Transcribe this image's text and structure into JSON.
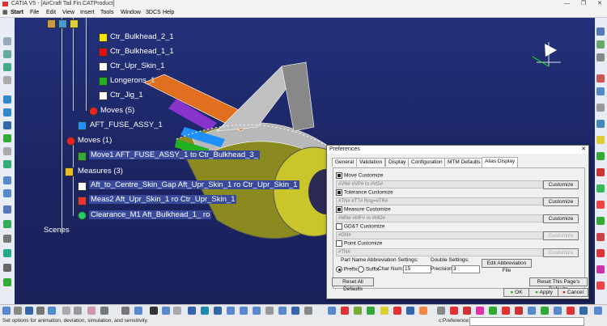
{
  "window": {
    "title": "CATIA V5 - [AirCraft Tail Fin.CATProduct]",
    "controls": [
      "—",
      "❐",
      "✕"
    ]
  },
  "menu": [
    "Start",
    "File",
    "Edit",
    "View",
    "Insert",
    "Tools",
    "Window",
    "3DCS",
    "Help"
  ],
  "tree": {
    "items": [
      {
        "label": "Ctr_Bulkhead_2_1",
        "color": "#f5e400"
      },
      {
        "label": "Ctr_Bulkhead_1_1",
        "color": "#e01010"
      },
      {
        "label": "Ctr_Upr_Skin_1",
        "color": "#ffffff"
      },
      {
        "label": "Longerons_1",
        "color": "#20b020"
      },
      {
        "label": "Ctr_Jig_1",
        "color": "#ffffff"
      },
      {
        "label": "Moves (5)"
      },
      {
        "label": "AFT_FUSE_ASSY_1",
        "color": "#1e90ff"
      },
      {
        "label": "Moves (1)"
      },
      {
        "label": "Move1 AFT_FUSE_ASSY_1 to Ctr_Bulkhead_3_"
      },
      {
        "label": "Measures (3)"
      },
      {
        "label": "Aft_to_Centre_Skin_Gap Aft_Upr_Skin_1 ro Ctr_Upr_Skin_1"
      },
      {
        "label": "Meas2 Aft_Upr_Skin_1 ro Ctr_Upr_Skin_1"
      },
      {
        "label": "Clearance_M1 Aft_Bulkhead_1_ ro"
      },
      {
        "label": "Scenes"
      }
    ]
  },
  "dialog": {
    "title": "Preferences",
    "tabs": [
      "General",
      "Validation",
      "Display",
      "Configuration",
      "MTM Defaults",
      "Alias Display"
    ],
    "active_tab": "Alias Display",
    "sections": [
      {
        "label": "Move Customize",
        "checked": true,
        "value": "#VN# #VP# to #VG#",
        "button": "Customize",
        "enabled": true
      },
      {
        "label": "Tolerance Customize",
        "checked": true,
        "value": "#TN# #TT# Rng=#TR#",
        "button": "Customize",
        "enabled": true
      },
      {
        "label": "Measure Customize",
        "checked": true,
        "value": "#MN# #MF# ro #MO#",
        "button": "Customize",
        "enabled": true
      },
      {
        "label": "GD&T Customize",
        "checked": false,
        "value": "#GN#",
        "button": "Customize",
        "enabled": false
      },
      {
        "label": "Point Customize",
        "checked": false,
        "value": "#TN#",
        "button": "Customize",
        "enabled": false
      }
    ],
    "abbrev": {
      "group_label": "Part Name Abbreviation Settings:",
      "prefix_label": "Prefix",
      "suffix_label": "Suffix",
      "char_num_label": "Char Num:",
      "char_num_value": "15",
      "double_label": "Double Settings:",
      "precision_label": "Precision:",
      "precision_value": "3",
      "edit_button": "Edit Abbreviation File"
    },
    "reset_all": "Reset All Defaults",
    "reset_page": "Reset This Page's Defaults",
    "ok": "OK",
    "apply": "Apply",
    "cancel": "Cancel"
  },
  "status": {
    "message": "Set options for animation, deviation, simulation, and sensitivity.",
    "preference_label": "c:Preference:"
  }
}
